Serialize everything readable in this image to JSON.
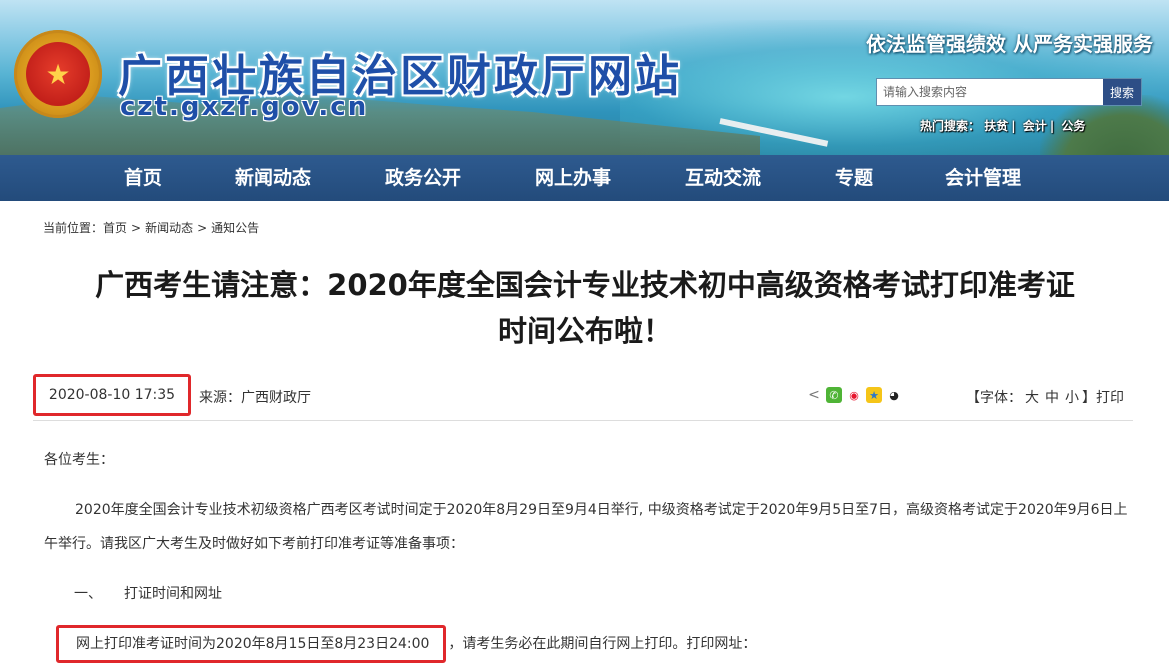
{
  "banner": {
    "site_title": "广西壮族自治区财政厅网站",
    "site_domain": "czt.gxzf.gov.cn",
    "slogan": "依法监管强绩效  从严务实强服务",
    "search": {
      "placeholder": "请输入搜索内容",
      "button_label": "搜索"
    },
    "hot_search": {
      "label": "热门搜索：",
      "items": [
        "扶贫",
        "会计",
        "公务"
      ]
    }
  },
  "nav": {
    "items": [
      "首页",
      "新闻动态",
      "政务公开",
      "网上办事",
      "互动交流",
      "专题",
      "会计管理"
    ]
  },
  "breadcrumb": {
    "label": "当前位置：",
    "items": [
      "首页",
      "新闻动态",
      "通知公告"
    ],
    "separator": ">"
  },
  "article": {
    "title_line1": "广西考生请注意：2020年度全国会计专业技术初中高级资格考试打印准考证",
    "title_line2": "时间公布啦！",
    "date": "2020-08-10 17:35",
    "source": "来源：广西财政厅",
    "font_control": {
      "prefix": "【字体：",
      "large": "大",
      "medium": "中",
      "small": "小",
      "suffix": "】",
      "print": "打印"
    },
    "greeting": "各位考生：",
    "body": "2020年度全国会计专业技术初级资格广西考区考试时间定于2020年8月29日至9月4日举行, 中级资格考试定于2020年9月5日至7日，高级资格考试定于2020年9月6日上午举行。请我区广大考生及时做好如下考前打印准考证等准备事项：",
    "section1_number": "一、",
    "section1_title": "打证时间和网址",
    "print_highlight": "网上打印准考证时间为2020年8月15日至8月23日24:00",
    "print_rest": "，请考生务必在此期间自行网上打印。打印网址："
  },
  "colors": {
    "nav_bg": "#2a5585",
    "title_blue": "#1f4fa8",
    "highlight_red": "#e0282b"
  },
  "icons": [
    "share-icon",
    "wechat-icon",
    "weibo-icon",
    "qzone-icon",
    "qq-icon"
  ]
}
